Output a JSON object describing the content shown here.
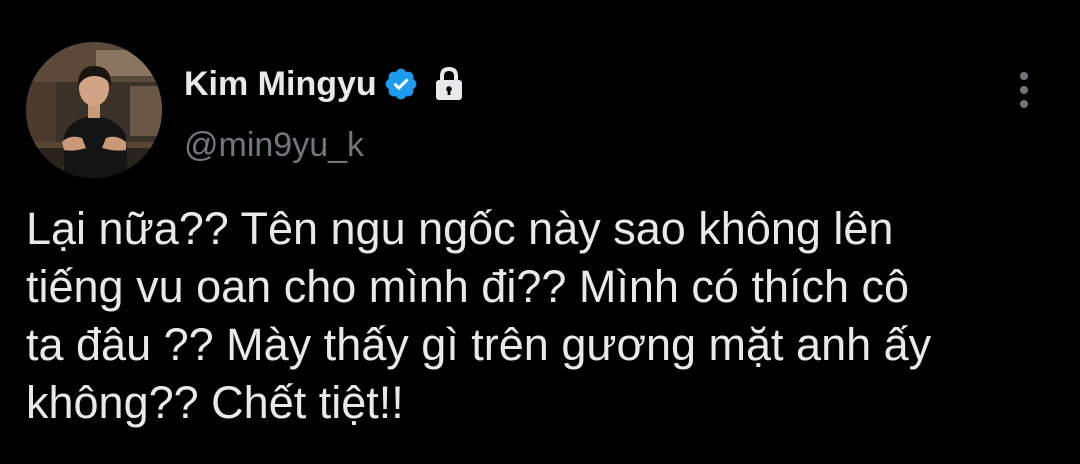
{
  "tweet": {
    "author": {
      "display_name": "Kim Mingyu",
      "handle": "@min9yu_k",
      "verified": true,
      "protected": true
    },
    "text": "Lại nữa?? Tên ngu ngốc này sao không lên\ntiếng vu oan cho mình đi?? Mình có thích cô\nta đâu ?? Mày thấy gì trên gương mặt anh ấy\nkhông?? Chết tiệt!!"
  },
  "icons": {
    "verified": "verified-badge-icon",
    "lock": "lock-icon",
    "more": "more-vertical-icon"
  },
  "colors": {
    "background": "#000000",
    "text_primary": "#e7e9ea",
    "text_secondary": "#71767b",
    "verified_blue": "#1d9bf0"
  }
}
